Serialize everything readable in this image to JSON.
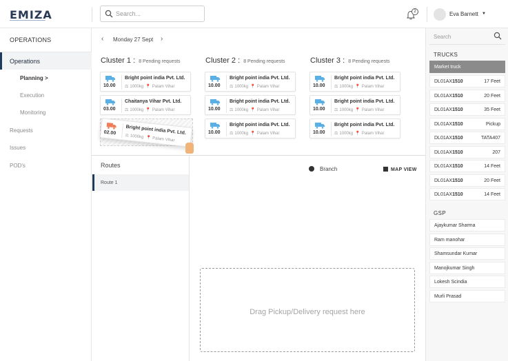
{
  "header": {
    "logo": "EMIZA",
    "search_placeholder": "Search...",
    "notification_count": "2",
    "user_name": "Eva Barnett"
  },
  "sidebar": {
    "title": "OPERATIONS",
    "items": [
      {
        "label": "Operations"
      },
      {
        "label": "Planning >"
      },
      {
        "label": "Execution"
      },
      {
        "label": "Monitoring"
      },
      {
        "label": "Requests"
      },
      {
        "label": "Issues"
      },
      {
        "label": "POD's"
      }
    ]
  },
  "date_nav": {
    "date": "Monday 27 Sept"
  },
  "clusters": [
    {
      "title": "Cluster 1 :",
      "pending": "8 Pending requests",
      "cards": [
        {
          "time": "10.00",
          "name": "Bright point india Pvt. Ltd.",
          "weight": "1000kg",
          "location": "Palam Vihar"
        },
        {
          "time": "03.00",
          "name": "Chaitanya Vihar Pvt. Ltd.",
          "weight": "1000kg",
          "location": "Palam Vihar"
        },
        {
          "time": "02.00",
          "name": "Bright point india Pvt. Ltd.",
          "weight": "1000kg",
          "location": "Palam Vihar"
        }
      ]
    },
    {
      "title": "Cluster 2 :",
      "pending": "8 Pending requests",
      "cards": [
        {
          "time": "10.00",
          "name": "Bright point india Pvt. Ltd.",
          "weight": "1000kg",
          "location": "Palam Vihar"
        },
        {
          "time": "10.00",
          "name": "Bright point india Pvt. Ltd.",
          "weight": "1000kg",
          "location": "Palam Vihar"
        },
        {
          "time": "10.00",
          "name": "Bright point india Pvt. Ltd.",
          "weight": "1000kg",
          "location": "Palam Vihar"
        }
      ]
    },
    {
      "title": "Cluster 3 :",
      "pending": "8 Pending requests",
      "cards": [
        {
          "time": "10.00",
          "name": "Bright point india Pvt. Ltd.",
          "weight": "1000kg",
          "location": "Palam Vihar"
        },
        {
          "time": "10.00",
          "name": "Bright point india Pvt. Ltd.",
          "weight": "1000kg",
          "location": "Palam Vihar"
        },
        {
          "time": "10.00",
          "name": "Bright point india Pvt. Ltd.",
          "weight": "1000kg",
          "location": "Palam Vihar"
        }
      ]
    }
  ],
  "routes": {
    "title": "Routes",
    "items": [
      {
        "label": "Route 1"
      }
    ]
  },
  "map": {
    "legend_label": "Branch",
    "map_view_label": "MAP VIEW",
    "dropzone_text": "Drag Pickup/Delivery request here"
  },
  "right_panel": {
    "search_placeholder": "Search",
    "trucks_title": "TRUCKS",
    "trucks": [
      {
        "plate_prefix": "Market truck",
        "plate_number": "",
        "type": ""
      },
      {
        "plate_prefix": "DL01AX",
        "plate_number": "1510",
        "type": "17 Feet"
      },
      {
        "plate_prefix": "DL01AX",
        "plate_number": "1510",
        "type": "20 Feet"
      },
      {
        "plate_prefix": "DL01AX",
        "plate_number": "1510",
        "type": "35 Feet"
      },
      {
        "plate_prefix": "DL01AX",
        "plate_number": "1510",
        "type": "Pickup"
      },
      {
        "plate_prefix": "DL01AX",
        "plate_number": "1510",
        "type": "TATA407"
      },
      {
        "plate_prefix": "DL01AX",
        "plate_number": "1510",
        "type": "207"
      },
      {
        "plate_prefix": "DL01AX",
        "plate_number": "1510",
        "type": "14 Feet"
      },
      {
        "plate_prefix": "DL01AX",
        "plate_number": "1510",
        "type": "20 Feet"
      },
      {
        "plate_prefix": "DL01AX",
        "plate_number": "1510",
        "type": "14 Feet"
      }
    ],
    "gsp_title": "GSP",
    "gsp": [
      {
        "name": "Ajaykumar Sharma"
      },
      {
        "name": "Ram manohar"
      },
      {
        "name": "Shamsundar Kumar"
      },
      {
        "name": "Manojkumar Singh"
      },
      {
        "name": "Lokesh Scindia"
      },
      {
        "name": "Murli Prasad"
      }
    ]
  },
  "colors": {
    "accent": "#1e3a5f",
    "truck_icon": "#5ab0e6",
    "dragged_truck_icon": "#ef7d57",
    "selected_truck_bg": "#8b8b8b"
  }
}
